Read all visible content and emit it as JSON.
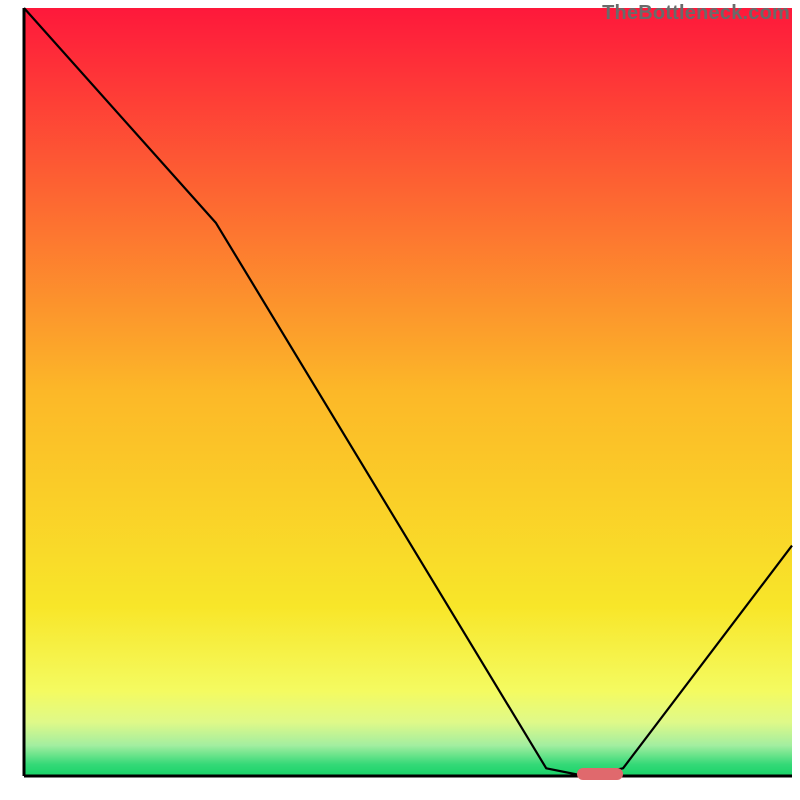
{
  "watermark": "TheBottleneck.com",
  "chart_data": {
    "type": "line",
    "title": "",
    "xlabel": "",
    "ylabel": "",
    "xlim": [
      0,
      100
    ],
    "ylim": [
      0,
      100
    ],
    "x": [
      0,
      25,
      68,
      73,
      78,
      100
    ],
    "values": [
      100,
      72,
      1,
      0,
      1,
      30
    ],
    "marker": {
      "x_start": 72,
      "x_end": 78,
      "y": 0,
      "color": "#e0696d"
    },
    "gradient_stops": [
      {
        "offset": 0.0,
        "color": "#fe183b"
      },
      {
        "offset": 0.5,
        "color": "#fcb828"
      },
      {
        "offset": 0.78,
        "color": "#f8e629"
      },
      {
        "offset": 0.89,
        "color": "#f4fb61"
      },
      {
        "offset": 0.93,
        "color": "#dff989"
      },
      {
        "offset": 0.96,
        "color": "#a3eea0"
      },
      {
        "offset": 0.985,
        "color": "#34d977"
      },
      {
        "offset": 1.0,
        "color": "#17d368"
      }
    ],
    "background_box": {
      "x0": 3,
      "y0": 3,
      "x1": 99,
      "y1": 99
    },
    "axis_color": "#000000",
    "line_color": "#000000",
    "line_width": 2.2
  }
}
